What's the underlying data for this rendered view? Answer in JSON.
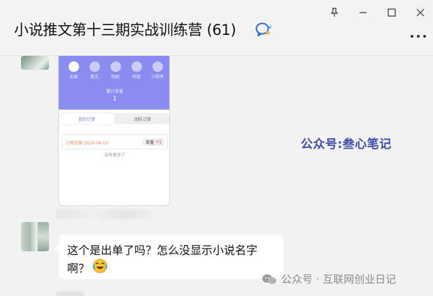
{
  "window": {
    "title": "小说推文第十三期实战训练营 (61)",
    "controls": {
      "pin": "pin-icon",
      "minimize": "minimize-icon",
      "maximize": "maximize-icon",
      "close": "close-icon"
    },
    "more": "more-icon"
  },
  "image_message": {
    "icons": [
      {
        "label": "全部",
        "active": true
      },
      {
        "label": "推文",
        "active": false
      },
      {
        "label": "短剧",
        "active": false
      },
      {
        "label": "网盘",
        "active": false
      },
      {
        "label": "小程序",
        "active": false
      }
    ],
    "summary_label": "累计单量",
    "summary_value": "1",
    "tabs": [
      "我的订单",
      "团队订单"
    ],
    "order_date": "订单日期 2024-04-03",
    "badge_label": "单量",
    "badge_value": "+1",
    "no_more": "没有更多了"
  },
  "message": {
    "line1": "这个是出单了吗？怎么没显示小说名字",
    "line2": "啊？",
    "emoji": "crying-laughing-emoji"
  },
  "watermarks": {
    "top": "公众号:叁心笔记",
    "bottom": "公众号 · 互联网创业日记"
  },
  "colors": {
    "accent_purple": "#8a8cf0",
    "watermark_blue": "#3f4fa8"
  }
}
